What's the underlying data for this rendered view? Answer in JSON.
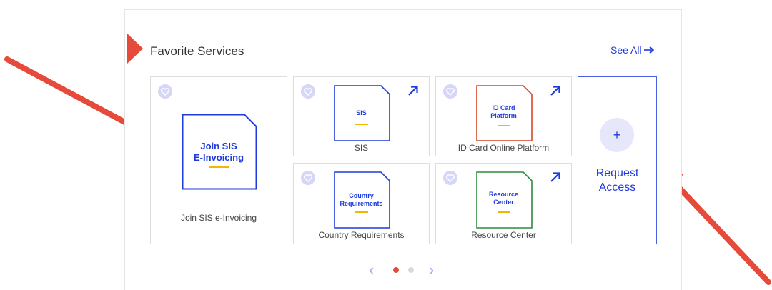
{
  "section": {
    "title": "Favorite Services",
    "see_all": "See All"
  },
  "cards": [
    {
      "doc_label_1": "Join SIS",
      "doc_label_2": "E-Invoicing",
      "caption": "Join SIS e-Invoicing",
      "doc_color": "#1f3bdc",
      "external_link": false
    },
    {
      "doc_label_1": "SIS",
      "caption": "SIS",
      "doc_color": "#1f3bdc",
      "external_link": true
    },
    {
      "doc_label_1": "ID Card",
      "doc_label_2": "Platform",
      "caption": "ID Card Online Platform",
      "doc_color": "#d9472b",
      "external_link": true
    },
    {
      "doc_label_1": "Country",
      "doc_label_2": "Requirements",
      "caption": "Country Requirements",
      "doc_color": "#1f3bdc",
      "external_link": false
    },
    {
      "doc_label_1": "Resource",
      "doc_label_2": "Center",
      "caption": "Resource Center",
      "doc_color": "#2e8b3d",
      "external_link": true
    }
  ],
  "request_access": {
    "symbol": "+",
    "line1": "Request",
    "line2": "Access"
  },
  "pager": {
    "prev": "‹",
    "next": "›",
    "pages": 2,
    "active_page": 1
  },
  "colors": {
    "accent": "#1f3bdc",
    "annotation_arrow": "#e64a3b",
    "underline": "#f2b705"
  }
}
